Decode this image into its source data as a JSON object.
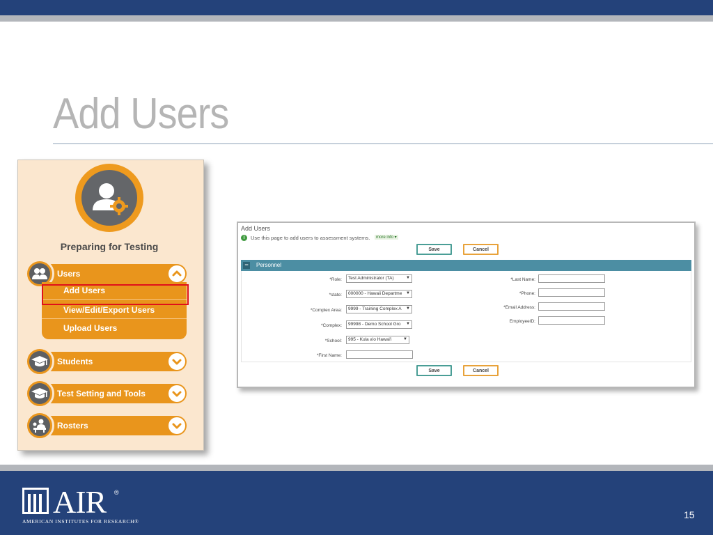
{
  "slide": {
    "title": "Add Users",
    "page_number": "15",
    "logo": {
      "word": "AIR",
      "registered": "®",
      "subtitle": "AMERICAN INSTITUTES FOR RESEARCH®"
    },
    "colors": {
      "brand_blue": "#24427a",
      "stripe_gray": "#b3b6bb",
      "menu_orange": "#e9951c",
      "highlight_red": "#e0101a"
    }
  },
  "menu": {
    "title": "Preparing for Testing",
    "hero_icon": "user-gear-icon",
    "sections": [
      {
        "label": "Users",
        "icon": "users-icon",
        "expanded": true
      },
      {
        "label": "Students",
        "icon": "graduation-cap-icon",
        "expanded": false
      },
      {
        "label": "Test Setting and Tools",
        "icon": "graduation-cap-icon",
        "expanded": false
      },
      {
        "label": "Rosters",
        "icon": "classroom-icon",
        "expanded": false
      }
    ],
    "users_submenu": [
      "Add Users",
      "View/Edit/Export Users",
      "Upload Users"
    ],
    "highlighted_item": "Add Users"
  },
  "form": {
    "title": "Add Users",
    "info_text": "Use this page to add users to assessment systems.",
    "more_info": "more info ▾",
    "save_label": "Save",
    "cancel_label": "Cancel",
    "section_toggle": "−",
    "section_label": "Personnel",
    "left_fields": [
      {
        "label": "*Role:",
        "value": "Test Administrator (TA)",
        "type": "select"
      },
      {
        "label": "*state:",
        "value": "000000 - Hawaii Departme",
        "type": "select"
      },
      {
        "label": "*Complex Area:",
        "value": "9999 - Training Complex A",
        "type": "select"
      },
      {
        "label": "*Complex:",
        "value": "99998 - Demo School Gro",
        "type": "select"
      },
      {
        "label": "*School:",
        "value": "995 - Kula a'o Hawai'i",
        "type": "select"
      },
      {
        "label": "*First Name:",
        "value": "",
        "type": "input"
      }
    ],
    "right_fields": [
      {
        "label": "*Last Name:",
        "value": ""
      },
      {
        "label": "*Phone:",
        "value": ""
      },
      {
        "label": "*Email Address:",
        "value": ""
      },
      {
        "label": "EmployeeID:",
        "value": ""
      }
    ]
  }
}
